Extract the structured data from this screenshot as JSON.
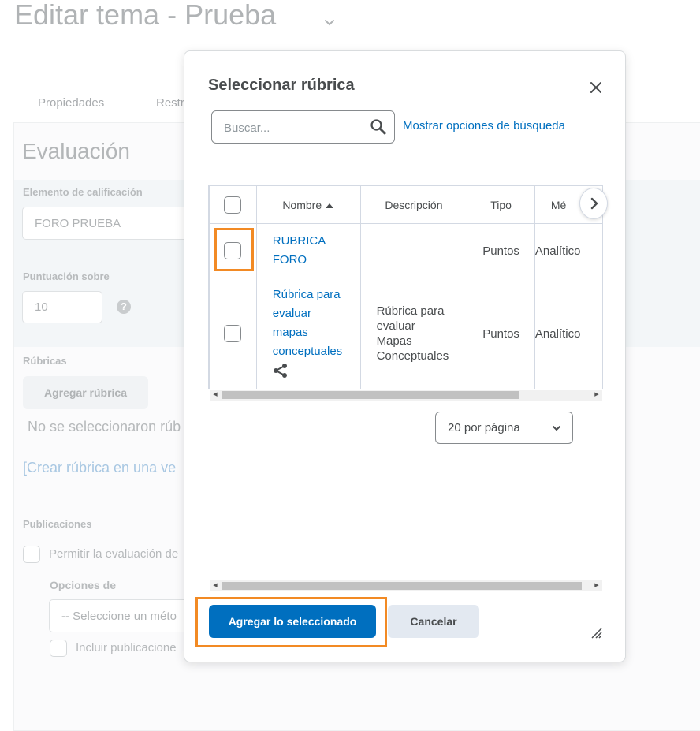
{
  "background": {
    "page_title": "Editar tema - Prueba",
    "tabs": [
      "Propiedades",
      "Restr"
    ],
    "section_title": "Evaluación",
    "grade_item_label": "Elemento de calificación",
    "grade_item_value": "FORO PRUEBA",
    "score_label": "Puntuación sobre",
    "score_value": "10",
    "rubrics_label": "Rúbricas",
    "add_rubric_button": "Agregar rúbrica",
    "no_rubrics_text": "No se seleccionaron rúb",
    "create_rubric_link": "[Crear rúbrica en una ve",
    "publications_label": "Publicaciones",
    "allow_eval_label": "Permitir la evaluación de",
    "options_label": "Opciones de",
    "method_select_placeholder": "-- Seleccione un méto",
    "include_publications_label": "Incluir publicacione"
  },
  "dialog": {
    "title": "Seleccionar rúbrica",
    "close_icon": "close-icon",
    "search": {
      "placeholder": "Buscar...",
      "icon": "search-icon",
      "options_link": "Mostrar opciones de búsqueda"
    },
    "table": {
      "columns": [
        "Nombre",
        "Descripción",
        "Tipo",
        "Mé"
      ],
      "sort_indicator": "ascending",
      "rows": [
        {
          "name_lines": [
            "RUBRICA",
            "FORO"
          ],
          "description_lines": [],
          "type": "Puntos",
          "method": "Analítico",
          "shared": false,
          "checked": false
        },
        {
          "name_lines": [
            "Rúbrica para",
            "evaluar",
            "mapas",
            "conceptuales"
          ],
          "description_lines": [
            "Rúbrica para",
            "evaluar",
            "Mapas",
            "Conceptuales"
          ],
          "type": "Puntos",
          "method": "Analítico",
          "shared": true,
          "checked": false
        }
      ]
    },
    "per_page": "20 por página",
    "primary_button": "Agregar lo seleccionado",
    "cancel_button": "Cancelar"
  },
  "colors": {
    "link": "#006fbf",
    "primary": "#006fbf",
    "highlight": "#f28a24",
    "border": "#d3d9e3"
  }
}
